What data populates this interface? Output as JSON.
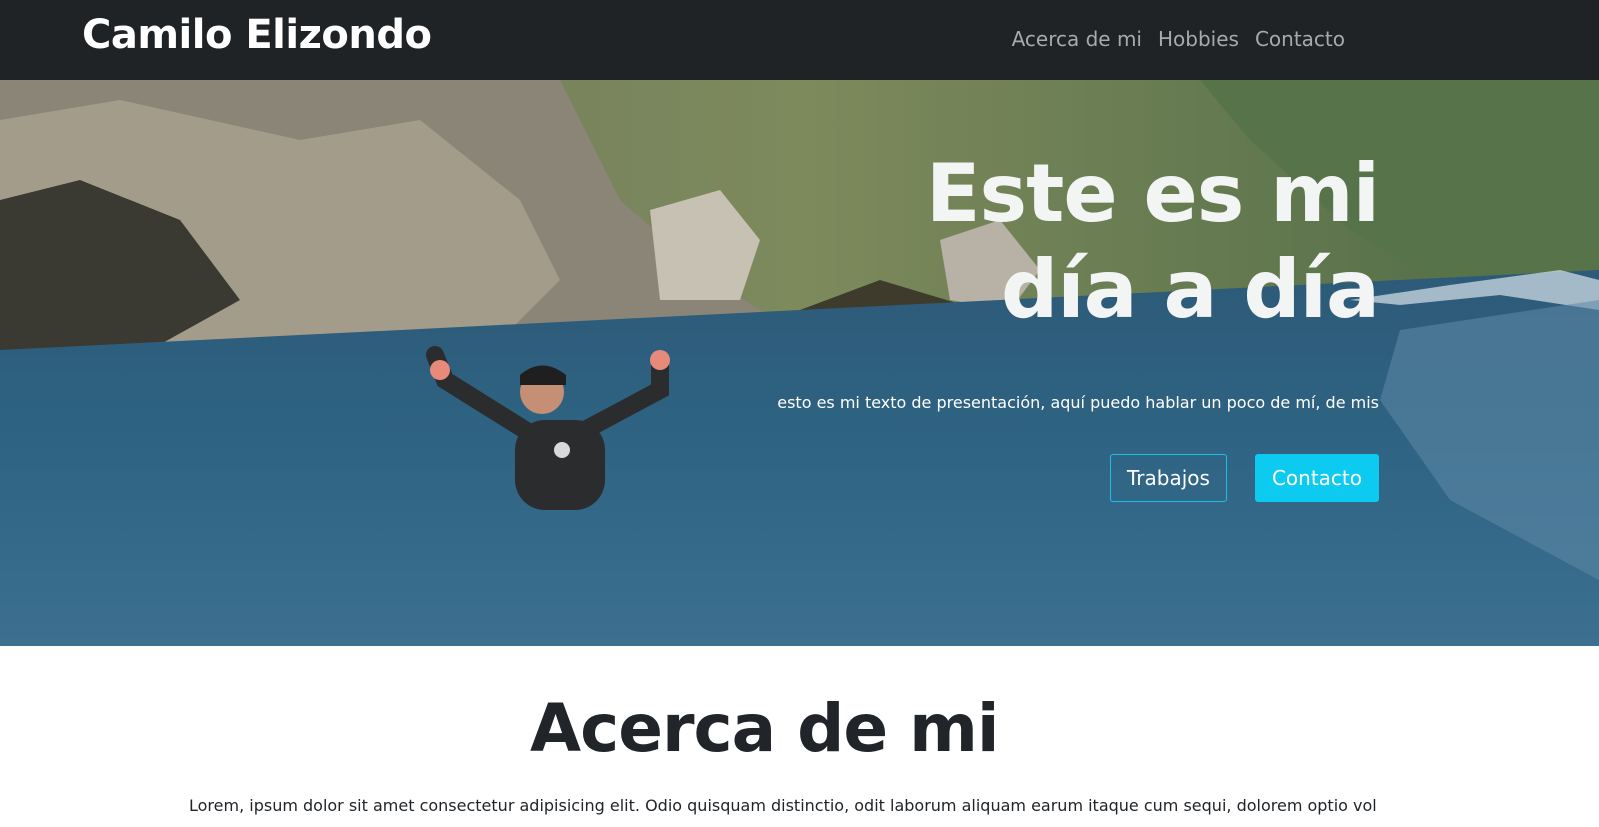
{
  "navbar": {
    "brand": "Camilo Elizondo",
    "links": [
      "Acerca de mi",
      "Hobbies",
      "Contacto"
    ]
  },
  "hero": {
    "title_line1": "Este es mi",
    "title_line2": "día a día",
    "subtitle": "esto es mi texto de presentación, aquí puedo hablar un poco de mí, de mis",
    "buttons": [
      "Trabajos",
      "Contacto"
    ]
  },
  "about": {
    "title": "Acerca de mi",
    "text": "Lorem, ipsum dolor sit amet consectetur adipisicing elit. Odio quisquam distinctio, odit laborum aliquam earum itaque cum sequi, dolorem optio vol"
  },
  "colors": {
    "navbar_bg": "#1f2326",
    "accent": "#0dcaf0"
  }
}
